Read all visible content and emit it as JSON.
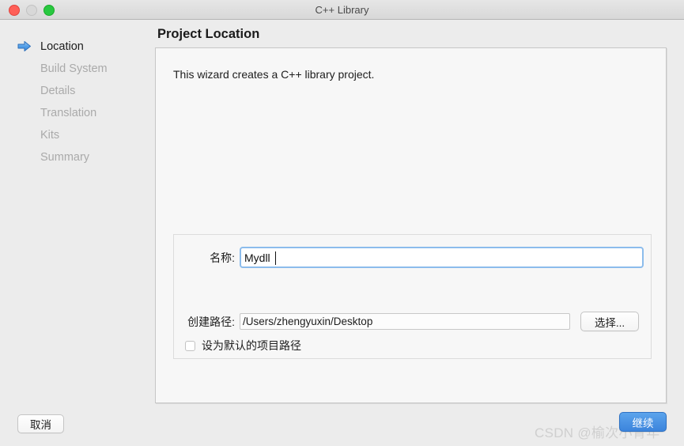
{
  "window": {
    "title": "C++ Library",
    "traffic_lights": [
      "close-red",
      "minimize-grey",
      "zoom-green"
    ]
  },
  "sidebar": {
    "items": [
      {
        "label": "Location",
        "state": "active",
        "icon": "blue-arrow-icon"
      },
      {
        "label": "Build System",
        "state": "dim",
        "icon": ""
      },
      {
        "label": "Details",
        "state": "dim",
        "icon": ""
      },
      {
        "label": "Translation",
        "state": "dim",
        "icon": ""
      },
      {
        "label": "Kits",
        "state": "dim",
        "icon": ""
      },
      {
        "label": "Summary",
        "state": "dim",
        "icon": ""
      }
    ]
  },
  "page": {
    "title": "Project Location",
    "description": "This wizard creates a C++ library project."
  },
  "form": {
    "name_label": "名称:",
    "name_value": "Mydll",
    "name_placeholder": "",
    "path_label": "创建路径:",
    "path_value": "/Users/zhengyuxin/Desktop",
    "path_placeholder": "",
    "choose_button": "选择...",
    "default_path_checkbox_label": "设为默认的项目路径",
    "default_path_checked": false
  },
  "footer": {
    "cancel_label": "取消",
    "continue_label": "继续",
    "watermark": "CSDN @榆次小青年"
  },
  "colors": {
    "window_background": "#ececec",
    "panel_background": "#f7f7f7",
    "panel_border": "#c6c6c6",
    "focus_ring": "#8cbcec",
    "accent_button": "#3c84dc",
    "dim_text": "#aaaaaa",
    "watermark": "#cfcfcf"
  }
}
